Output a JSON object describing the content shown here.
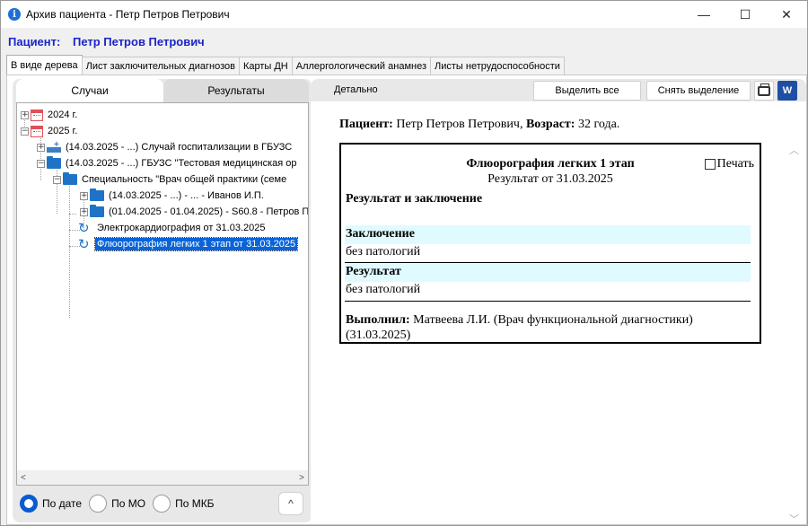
{
  "window": {
    "title": "Архив пациента - Петр Петров Петрович",
    "controls": {
      "minimize": "—",
      "maximize": "☐",
      "close": "✕"
    }
  },
  "patient_header": {
    "label": "Пациент:",
    "name": "Петр Петров Петрович"
  },
  "tabs": [
    {
      "label": "В виде дерева",
      "active": true
    },
    {
      "label": "Лист заключительных диагнозов"
    },
    {
      "label": "Карты ДН"
    },
    {
      "label": "Аллергологический анамнез"
    },
    {
      "label": "Листы нетрудоспособности"
    }
  ],
  "left_panel": {
    "tabs": {
      "cases": "Случаи",
      "results": "Результаты"
    },
    "tree": {
      "year_2024": "2024 г.",
      "year_2025": "2025 г.",
      "hosp_case": "(14.03.2025 - ...) Случай госпитализации в ГБУЗС",
      "org_case": "(14.03.2025 - ...) ГБУЗС \"Тестовая медицинская ор",
      "specialty": "Специальность \"Врач общей практики (семе",
      "visit1": "(14.03.2025 - ...) - ... - Иванов И.П.",
      "visit2": "(01.04.2025 - 01.04.2025) - S60.8 - Петров П.",
      "ecg": "Электрокардиография от 31.03.2025",
      "fluoro": "Флюорография легких 1 этап от 31.03.2025"
    },
    "scroll": {
      "left": "<",
      "right": ">"
    },
    "sort": {
      "by_date": "По дате",
      "by_mo": "По МО",
      "by_mkb": "По МКБ",
      "selected": "by_date"
    },
    "up_button": "^"
  },
  "right_panel": {
    "detail_tab": "Детально",
    "select_all": "Выделить все",
    "deselect": "Снять выделение",
    "word_label": "W",
    "patient_info": {
      "patient_label": "Пациент:",
      "patient_name": "Петр Петров Петрович,",
      "age_label": "Возраст:",
      "age_value": "32 года."
    },
    "report": {
      "title": "Флюорография легких 1 этап",
      "subtitle": "Результат от 31.03.2025",
      "print_label": "Печать",
      "heading": "Результат и заключение",
      "conclusion_label": "Заключение",
      "conclusion_value": "без патологий",
      "result_label": "Результат",
      "result_value": "без патологий",
      "executor_label": "Выполнил:",
      "executor_value": "Матвеева Л.И. (Врач функциональной диагностики) (31.03.2025)"
    }
  }
}
